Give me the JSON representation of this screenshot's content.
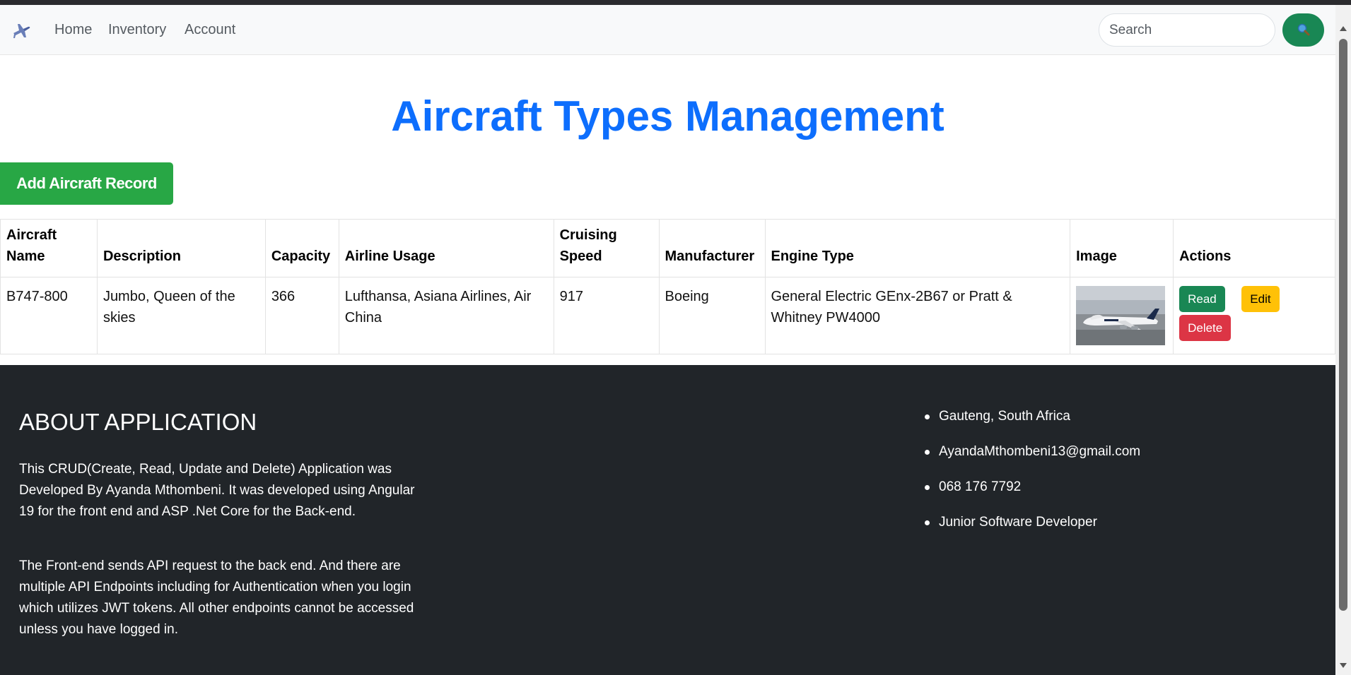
{
  "nav": {
    "links": [
      "Home",
      "Inventory",
      "Account"
    ],
    "search_placeholder": "Search"
  },
  "page": {
    "title": "Aircraft Types Management",
    "add_button_label": "Add Aircraft Record"
  },
  "table": {
    "headers": [
      "Aircraft Name",
      "Description",
      "Capacity",
      "Airline Usage",
      "Cruising Speed",
      "Manufacturer",
      "Engine Type",
      "Image",
      "Actions"
    ],
    "rows": [
      {
        "aircraft_name": "B747-800",
        "description": "Jumbo, Queen of the skies",
        "capacity": "366",
        "airline_usage": "Lufthansa, Asiana Airlines, Air China",
        "cruising_speed": "917",
        "manufacturer": "Boeing",
        "engine_type": "General Electric GEnx-2B67 or Pratt & Whitney PW4000",
        "actions": {
          "read": "Read",
          "edit": "Edit",
          "delete": "Delete"
        }
      }
    ]
  },
  "footer": {
    "heading": "ABOUT APPLICATION",
    "paragraphs": [
      "This CRUD(Create, Read, Update and Delete) Application was Developed By Ayanda Mthombeni. It was developed using Angular 19 for the front end and ASP .Net Core for the Back-end.",
      "The Front-end sends API request to the back end. And there are multiple API Endpoints including for Authentication when you login which utilizes JWT tokens. All other endpoints cannot be accessed unless you have logged in."
    ],
    "contact": [
      "Gauteng, South Africa",
      "AyandaMthombeni13@gmail.com",
      "068 176 7792",
      "Junior Software Developer"
    ]
  },
  "colors": {
    "title": "#0d6efd",
    "add_button": "#28a745",
    "read": "#198754",
    "edit": "#ffc107",
    "delete": "#dc3545",
    "footer_bg": "#212529"
  },
  "icons": {
    "brand": "airplane-icon",
    "search": "magnifier-icon"
  }
}
